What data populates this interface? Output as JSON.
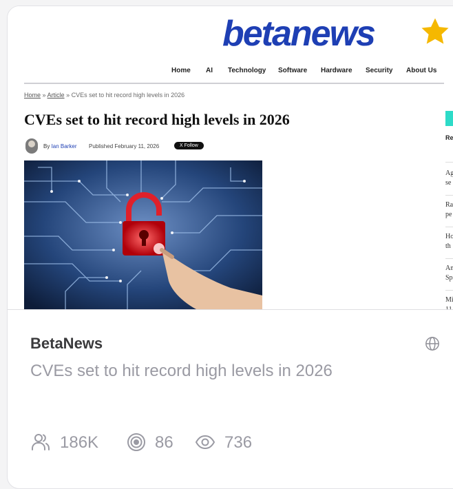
{
  "preview": {
    "logo_text": "betanews",
    "nav": [
      "Home",
      "AI",
      "Technology",
      "Software",
      "Hardware",
      "Security",
      "About Us"
    ],
    "breadcrumb": {
      "home": "Home",
      "article": "Article",
      "current": "CVEs set to hit record high levels in 2026"
    },
    "headline": "CVEs set to hit record high levels in 2026",
    "byline": {
      "by": "By",
      "author": "Ian Barker",
      "published": "Published February 11, 2026",
      "follow": "X Follow"
    },
    "sidebar": {
      "title": "Re",
      "items": [
        [
          "Ag",
          "se"
        ],
        [
          "Ra",
          "pe"
        ],
        [
          "Ho",
          "th"
        ],
        [
          "An",
          "Sp"
        ],
        [
          "Mi",
          "11"
        ]
      ]
    }
  },
  "card": {
    "source": "BetaNews",
    "title": "CVEs set to hit record high levels in 2026",
    "stats": {
      "followers": "186K",
      "targets": "86",
      "views": "736"
    }
  },
  "colors": {
    "brand": "#1e3fb4",
    "star": "#f5b800",
    "muted_text": "#9a9aa3",
    "accent_teal": "#2ddbc8"
  },
  "icons": [
    "star-icon",
    "globe-icon",
    "users-icon",
    "target-icon",
    "eye-icon"
  ]
}
